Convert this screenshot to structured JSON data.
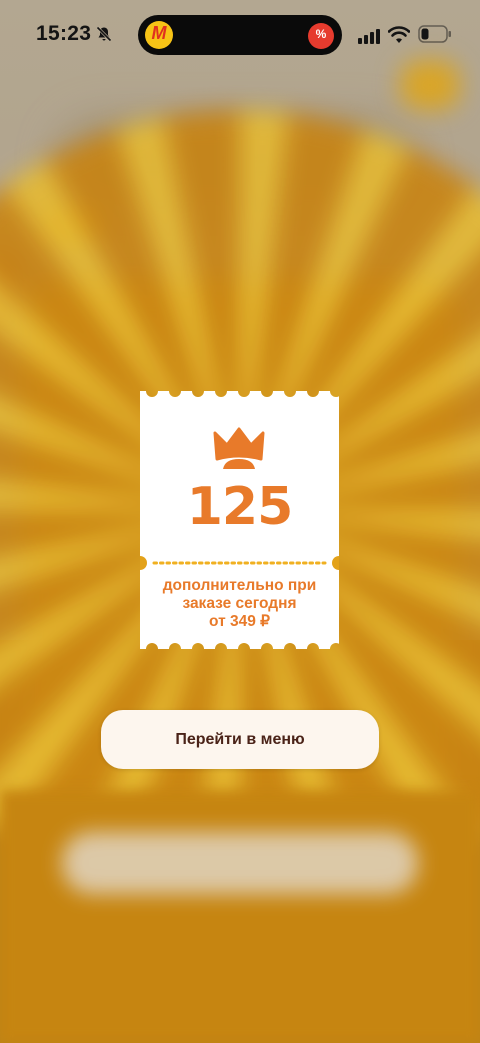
{
  "status_bar": {
    "time": "15:23",
    "app_badge_left_icon": "yandex-market-icon",
    "app_badge_left_glyph": "M",
    "app_badge_right_icon": "discount-icon",
    "app_badge_right_glyph": "%",
    "bell_icon": "bell-muted-icon",
    "signal_icon": "cellular-signal-icon",
    "wifi_icon": "wifi-icon",
    "battery_icon": "battery-low-icon"
  },
  "ticket": {
    "icon": "crown-icon",
    "points": "125",
    "description_line1": "дополнительно при",
    "description_line2": "заказе сегодня",
    "description_line3": "от 349 ₽"
  },
  "menu_button": {
    "label": "Перейти в меню"
  },
  "colors": {
    "accent": "#e87a2a",
    "ticket_bg": "#ffffff",
    "button_bg": "#fdf6ee",
    "button_text": "#4a2318",
    "background": "#c98a18"
  }
}
